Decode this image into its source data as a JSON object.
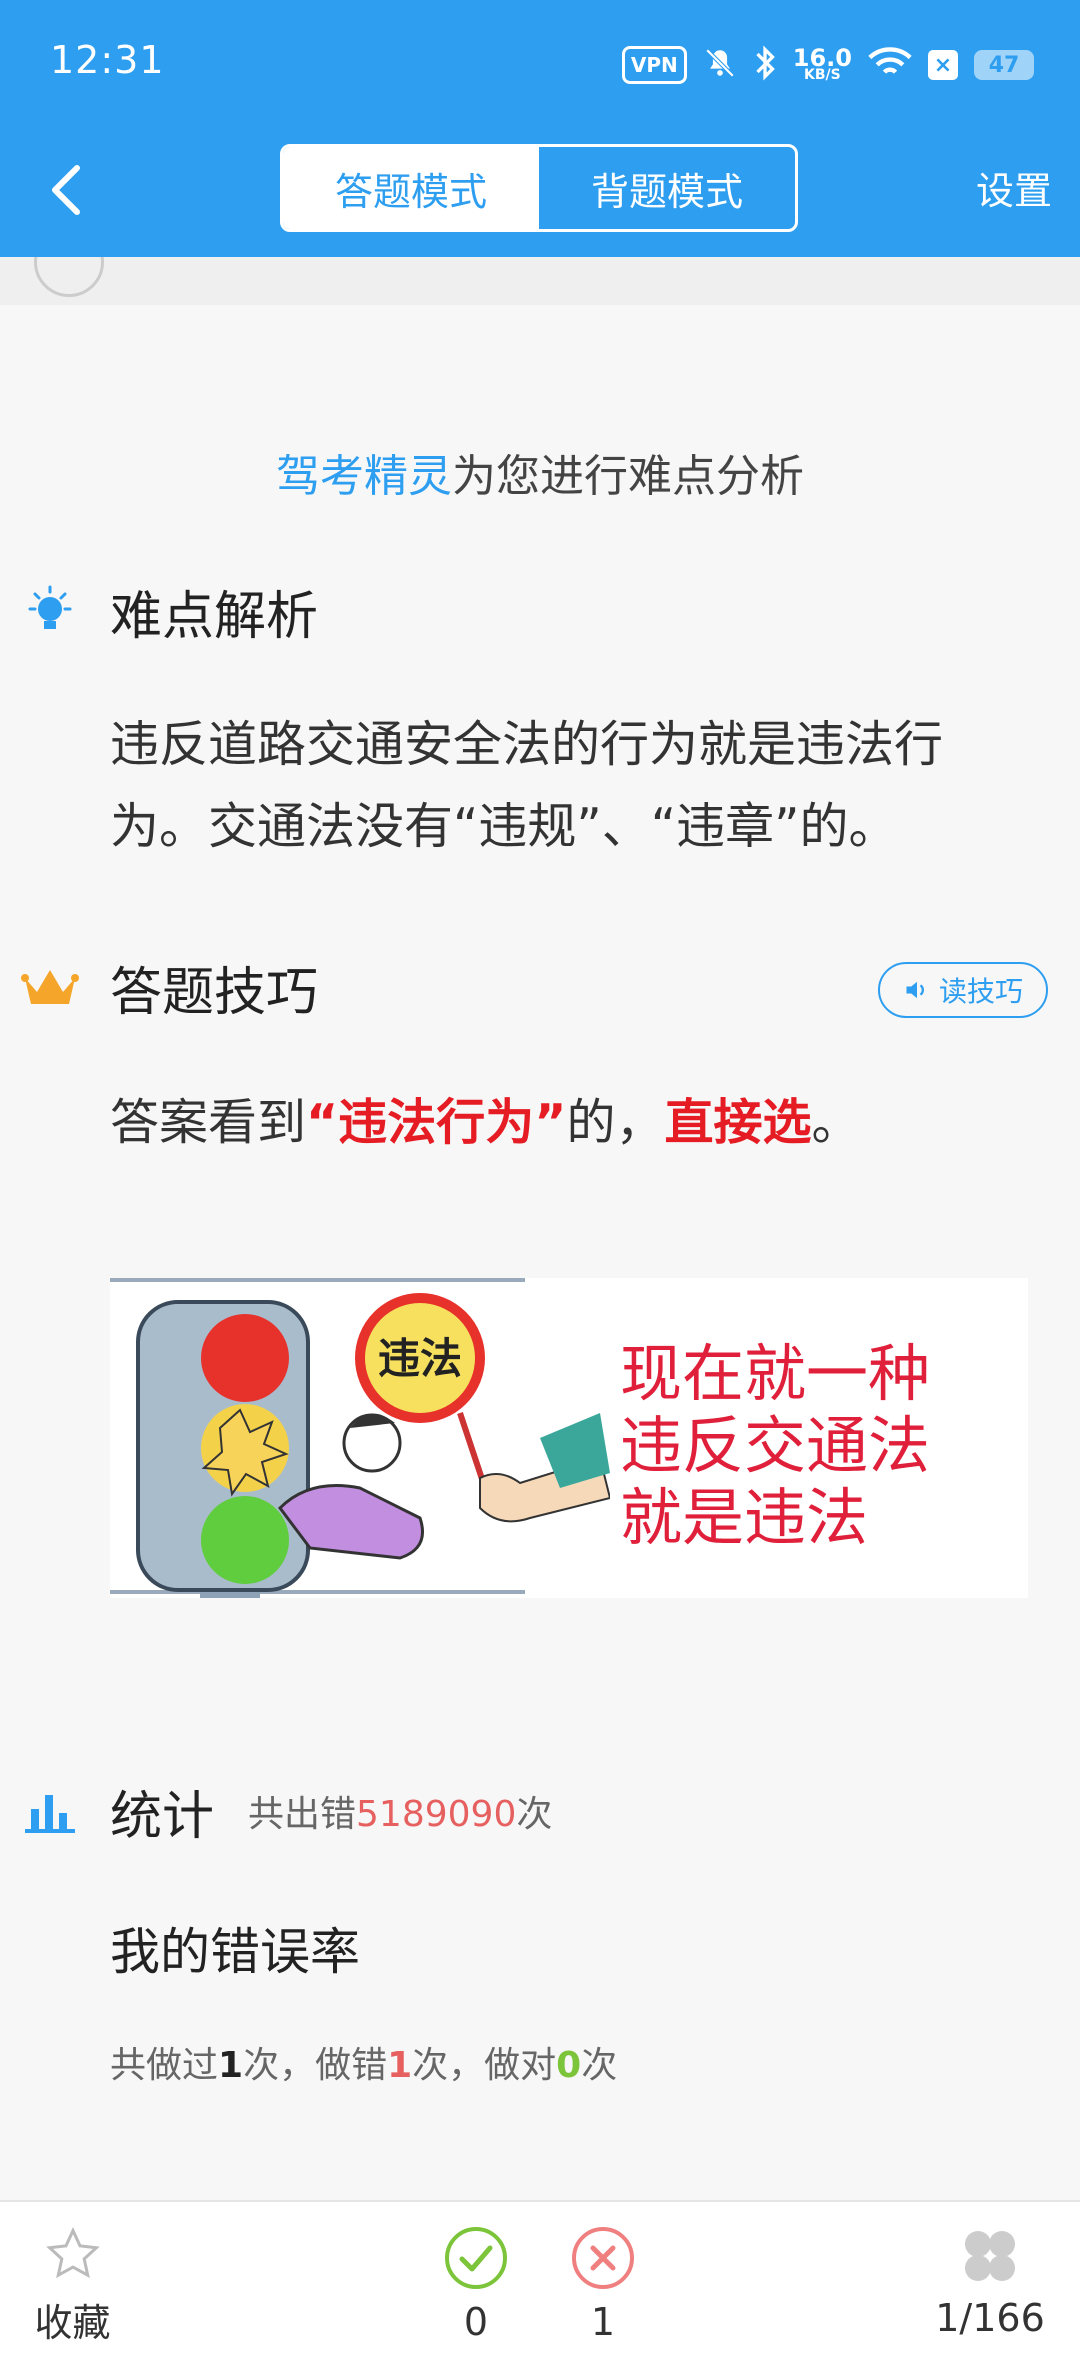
{
  "status_bar": {
    "time": "12:31",
    "vpn": "VPN",
    "speed_value": "16.0",
    "speed_unit": "KB/S",
    "battery": "47"
  },
  "header": {
    "tabs": [
      {
        "label": "答题模式",
        "active": true
      },
      {
        "label": "背题模式",
        "active": false
      }
    ],
    "settings_label": "设置"
  },
  "analysis": {
    "brand": "驾考精灵",
    "title_suffix": "为您进行难点分析"
  },
  "difficulty": {
    "heading": "难点解析",
    "text": "违反道路交通安全法的行为就是违法行为。交通法没有“违规”、“违章”的。"
  },
  "tips": {
    "heading": "答题技巧",
    "read_button": "读技巧",
    "text_prefix": "答案看到",
    "highlight_1": "“违法行为”",
    "text_mid": "的，",
    "highlight_2": "直接选",
    "text_suffix": "。"
  },
  "illustration": {
    "sign_text": "违法",
    "slogan_lines": [
      "现在就一种",
      "违反交通法",
      "就是违法"
    ]
  },
  "stats": {
    "heading": "统计",
    "sub_prefix": "共出错",
    "sub_count": "5189090",
    "sub_suffix": "次",
    "my_rate_label": "我的错误率",
    "detail": {
      "p1": "共做过",
      "done": "1",
      "p2": "次，做错",
      "wrong": "1",
      "p3": "次，做对",
      "right": "0",
      "p4": "次"
    }
  },
  "bottom_bar": {
    "favorite_label": "收藏",
    "correct_count": "0",
    "wrong_count": "1",
    "progress": "1/166"
  },
  "colors": {
    "primary": "#2e9ef0",
    "red": "#e51c23",
    "green": "#7cc43a"
  }
}
